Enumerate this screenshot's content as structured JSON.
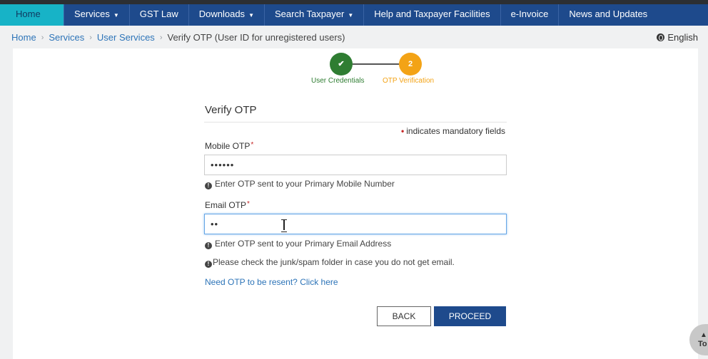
{
  "nav": {
    "items": [
      {
        "label": "Home",
        "caret": false
      },
      {
        "label": "Services",
        "caret": true
      },
      {
        "label": "GST Law",
        "caret": false
      },
      {
        "label": "Downloads",
        "caret": true
      },
      {
        "label": "Search Taxpayer",
        "caret": true
      },
      {
        "label": "Help and Taxpayer Facilities",
        "caret": false
      },
      {
        "label": "e-Invoice",
        "caret": false
      },
      {
        "label": "News and Updates",
        "caret": false
      }
    ]
  },
  "breadcrumb": {
    "home": "Home",
    "services": "Services",
    "user_services": "User Services",
    "current": "Verify OTP (User ID for unregistered users)"
  },
  "language": "English",
  "stepper": {
    "step1": {
      "symbol": "✔",
      "label": "User Credentials"
    },
    "step2": {
      "symbol": "2",
      "label": "OTP Verification"
    }
  },
  "form": {
    "title": "Verify OTP",
    "mandatory_note": "indicates mandatory fields",
    "mobile_label": "Mobile OTP",
    "mobile_value": "••••••",
    "mobile_hint": "Enter OTP sent to your Primary Mobile Number",
    "email_label": "Email OTP",
    "email_value": "••",
    "email_hint": "Enter OTP sent to your Primary Email Address",
    "spam_hint": "Please check the junk/spam folder in case you do not get email.",
    "resend_link": "Need OTP to be resent? Click here",
    "back_label": "BACK",
    "proceed_label": "PROCEED"
  },
  "to_top": "To",
  "colors": {
    "nav_bg": "#1e4a8c",
    "home_tab": "#17b3c7",
    "step_done": "#2f7d32",
    "step_active": "#f3a316",
    "link": "#2d74b8",
    "required": "#c62828"
  }
}
